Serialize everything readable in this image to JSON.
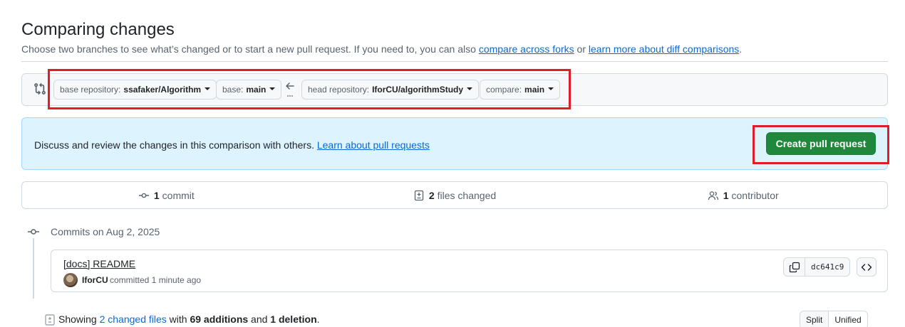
{
  "header": {
    "title": "Comparing changes",
    "subtitle_prefix": "Choose two branches to see what’s changed or to start a new pull request. If you need to, you can also",
    "link_forks": "compare across forks",
    "subtitle_or": "or",
    "link_learn_diff": "learn more about diff comparisons",
    "subtitle_end": "."
  },
  "range": {
    "base_repo_label": "base repository:",
    "base_repo_value": "ssafaker/Algorithm",
    "base_label": "base:",
    "base_value": "main",
    "arrow": "←",
    "head_repo_label": "head repository:",
    "head_repo_value": "IforCU/algorithmStudy",
    "compare_label": "compare:",
    "compare_value": "main"
  },
  "banner": {
    "text": "Discuss and review the changes in this comparison with others.",
    "link": "Learn about pull requests",
    "button": "Create pull request"
  },
  "summary": {
    "commits_count": "1",
    "commits_label": "commit",
    "files_count": "2",
    "files_label": "files changed",
    "contributors_count": "1",
    "contributors_label": "contributor"
  },
  "commits": {
    "date_heading": "Commits on Aug 2, 2025",
    "items": [
      {
        "message": "[docs] README",
        "author": "IforCU",
        "committed_text": "committed 1 minute ago",
        "sha": "dc641c9"
      }
    ]
  },
  "toc": {
    "showing": "Showing",
    "changed_files_link": "2 changed files",
    "with": "with",
    "additions": "69 additions",
    "and": "and",
    "deletions": "1 deletion",
    "end": "."
  },
  "view_toggle": {
    "split": "Split",
    "unified": "Unified"
  },
  "colors": {
    "accent": "#0969da",
    "primary_button": "#1f883d",
    "highlight_box": "#e01e2b",
    "banner_bg": "#ddf4ff"
  }
}
